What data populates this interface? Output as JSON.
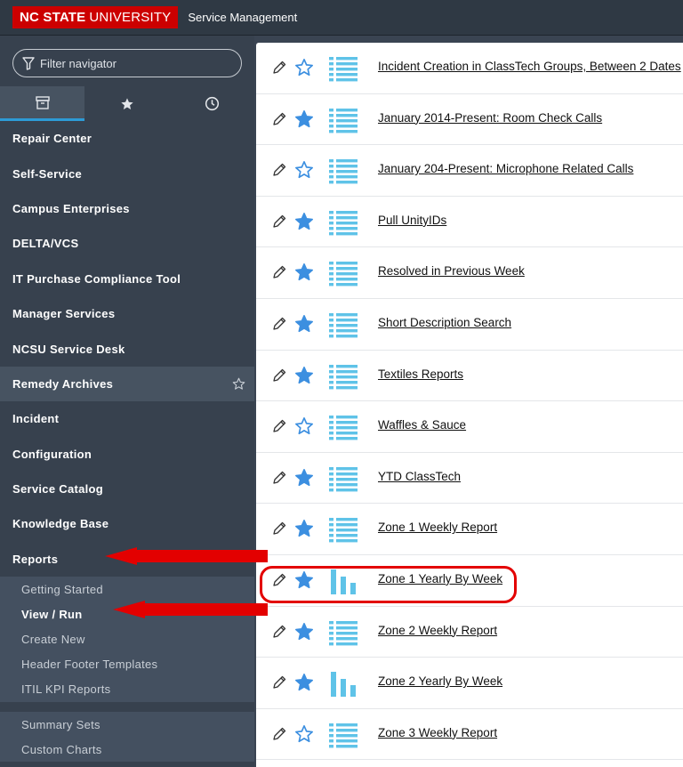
{
  "header": {
    "logo_bold": "NC STATE",
    "logo_rest": "UNIVERSITY",
    "title": "Service Management"
  },
  "sidebar": {
    "filter_placeholder": "Filter navigator",
    "tabs": [
      {
        "icon": "archive-icon"
      },
      {
        "icon": "star-icon"
      },
      {
        "icon": "clock-icon"
      }
    ],
    "items": [
      {
        "label": "Repair Center"
      },
      {
        "label": "Self-Service"
      },
      {
        "label": "Campus Enterprises"
      },
      {
        "label": "DELTA/VCS"
      },
      {
        "label": "IT Purchase Compliance Tool"
      },
      {
        "label": "Manager Services"
      },
      {
        "label": "NCSU Service Desk"
      },
      {
        "label": "Remedy Archives"
      },
      {
        "label": "Incident"
      },
      {
        "label": "Configuration"
      },
      {
        "label": "Service Catalog"
      },
      {
        "label": "Knowledge Base"
      },
      {
        "label": "Reports"
      }
    ],
    "reports_sub": [
      {
        "label": "Getting Started"
      },
      {
        "label": "View / Run"
      },
      {
        "label": "Create New"
      },
      {
        "label": "Header Footer Templates"
      },
      {
        "label": "ITIL KPI Reports"
      }
    ],
    "reports_sub2": [
      {
        "label": "Summary Sets"
      },
      {
        "label": "Custom Charts"
      }
    ]
  },
  "reports": [
    {
      "title": "Incident Creation in ClassTech Groups, Between 2 Dates",
      "favorite": false,
      "type": "list"
    },
    {
      "title": "January 2014-Present: Room Check Calls",
      "favorite": true,
      "type": "list"
    },
    {
      "title": "January 204-Present: Microphone Related Calls",
      "favorite": false,
      "type": "list"
    },
    {
      "title": "Pull UnityIDs",
      "favorite": true,
      "type": "list"
    },
    {
      "title": "Resolved in Previous Week",
      "favorite": true,
      "type": "list"
    },
    {
      "title": "Short Description Search",
      "favorite": true,
      "type": "list"
    },
    {
      "title": "Textiles Reports",
      "favorite": true,
      "type": "list"
    },
    {
      "title": "Waffles & Sauce",
      "favorite": false,
      "type": "list"
    },
    {
      "title": "YTD ClassTech",
      "favorite": true,
      "type": "list"
    },
    {
      "title": "Zone 1 Weekly Report",
      "favorite": true,
      "type": "list"
    },
    {
      "title": "Zone 1 Yearly By Week",
      "favorite": true,
      "type": "bar"
    },
    {
      "title": "Zone 2 Weekly Report",
      "favorite": true,
      "type": "list"
    },
    {
      "title": "Zone 2 Yearly By Week",
      "favorite": true,
      "type": "bar"
    },
    {
      "title": "Zone 3 Weekly Report",
      "favorite": false,
      "type": "list"
    }
  ],
  "colors": {
    "accent": "#2d9bd6",
    "star": "#3c8fe0",
    "icon": "#5fc3e8",
    "highlight": "#e30000",
    "brand": "#cc0000"
  }
}
